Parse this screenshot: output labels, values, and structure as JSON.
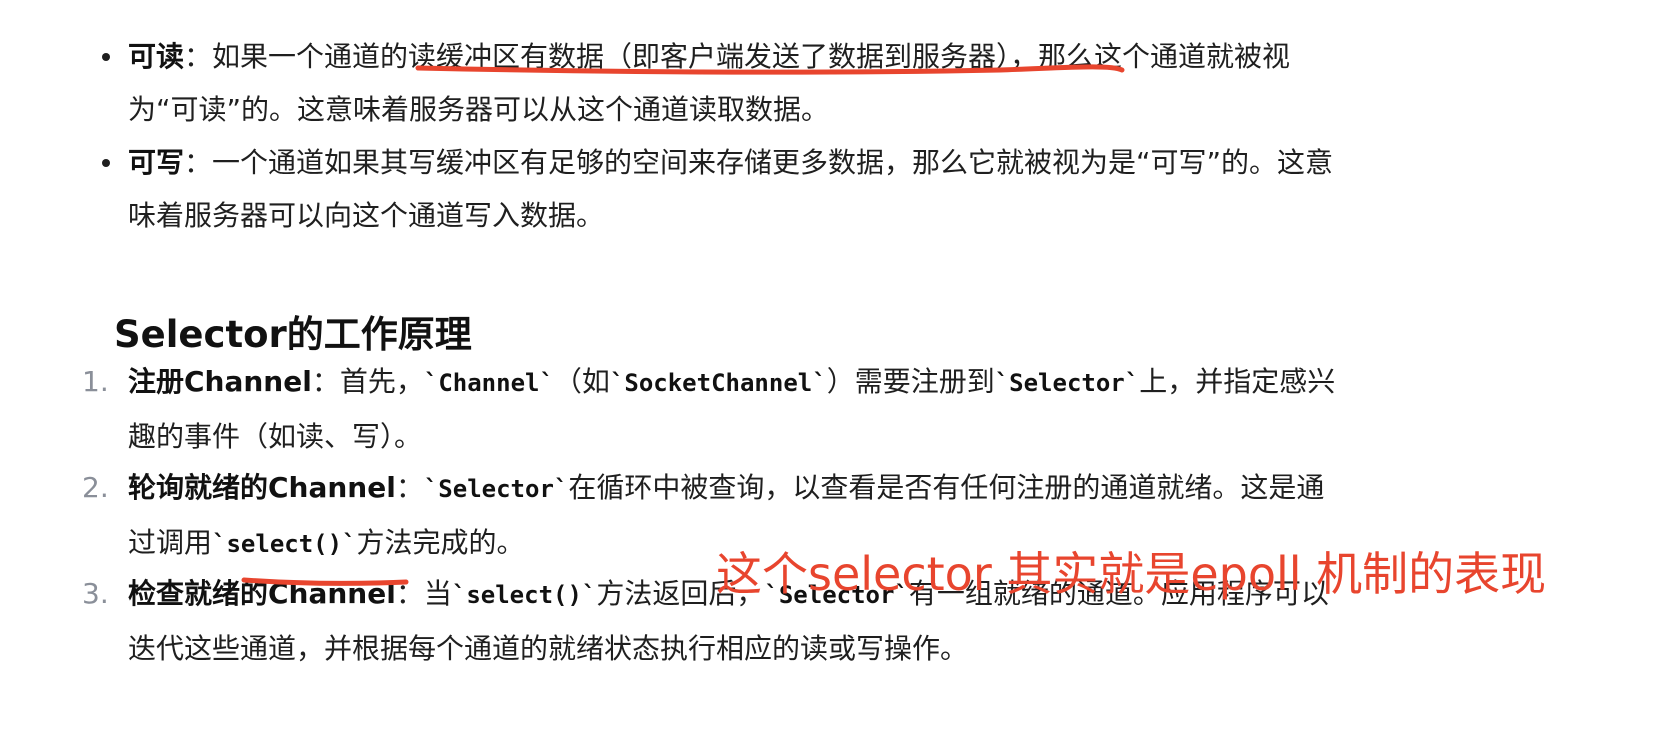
{
  "bullets": [
    {
      "term": "可读",
      "sep": "：",
      "line1_a": "如果一个通道的读缓冲区有数据（即客户端发送了数据到服务器），那么这个通道就被视",
      "line2": "为“可读”的。这意味着服务器可以从这个通道读取数据。"
    },
    {
      "term": "可写",
      "sep": "：",
      "line1_a": "一个通道如果其写缓冲区有足够的空间来存储更多数据，那么它就被视为是“可写”的。这意",
      "line2": "味着服务器可以向这个通道写入数据。"
    }
  ],
  "heading": "Selector的工作原理",
  "steps": [
    {
      "num": "1.",
      "term": "注册Channel",
      "sep": "：",
      "t1": "首先，",
      "c1": "`Channel`",
      "t2": "（如",
      "c2": "`SocketChannel`",
      "t3": "）需要注册到",
      "c3": "`Selector`",
      "t4": "上，并指定感兴",
      "line2": "趣的事件（如读、写）。"
    },
    {
      "num": "2.",
      "term": "轮询就绪的Channel",
      "sep": "：",
      "c1": "`Selector`",
      "t1": "在循环中被查询，以查看是否有任何注册的通道就绪。这是通",
      "l2a": "过调用",
      "l2c": "`select()`",
      "l2b": "方法完成的。"
    },
    {
      "num": "3.",
      "term": "检查就绪的Channel",
      "sep": "：",
      "t1": "当",
      "c1": "`select()`",
      "t2": "方法返回后，",
      "c2": "`Selector`",
      "t3": "有一组就绪的通道。应用程序可以",
      "line2": "迭代这些通道，并根据每个通道的就绪状态执行相应的读或写操作。"
    }
  ],
  "annotation": "这个selector 其实就是epoll 机制的表现",
  "colors": {
    "annotation": "#e8452e",
    "number": "#8a8f99",
    "text": "#1f1f1f"
  }
}
